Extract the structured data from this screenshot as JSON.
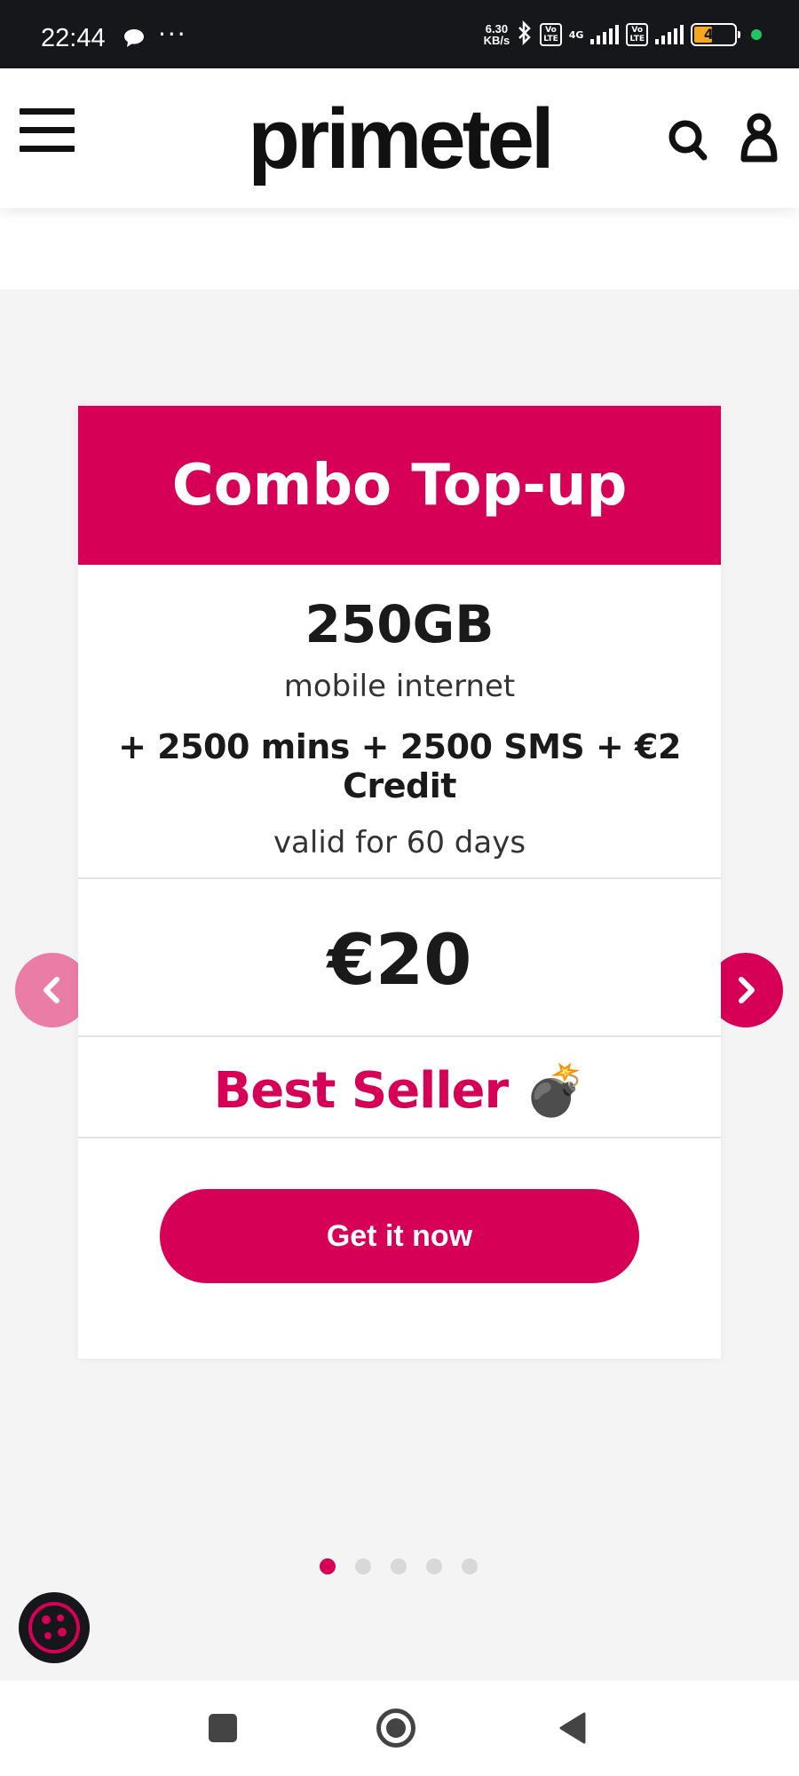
{
  "status_bar": {
    "time": "22:44",
    "net_speed_value": "6.30",
    "net_speed_unit": "KB/s",
    "volte_label": "Vo\nLTE",
    "network_type": "4G",
    "battery_level": "43",
    "icons": [
      "chat-icon",
      "more-icon",
      "bluetooth-icon",
      "signal-icon",
      "battery-icon"
    ]
  },
  "header": {
    "logo_text": "primetel",
    "icons": [
      "menu-icon",
      "search-icon",
      "user-icon"
    ]
  },
  "card": {
    "title": "Combo Top-up",
    "data_amount": "250GB",
    "data_label": "mobile internet",
    "extras": "+ 2500 mins + 2500 SMS + €2 Credit",
    "validity": "valid for 60 days",
    "price": "€20",
    "badge": "Best Seller 💣",
    "cta_label": "Get it now"
  },
  "carousel": {
    "total_slides": 5,
    "active_slide": 1
  },
  "colors": {
    "brand": "#d60057",
    "brand_light": "#ea7da6",
    "status_bar_bg": "#16171b",
    "page_bg": "#f4f4f5"
  }
}
